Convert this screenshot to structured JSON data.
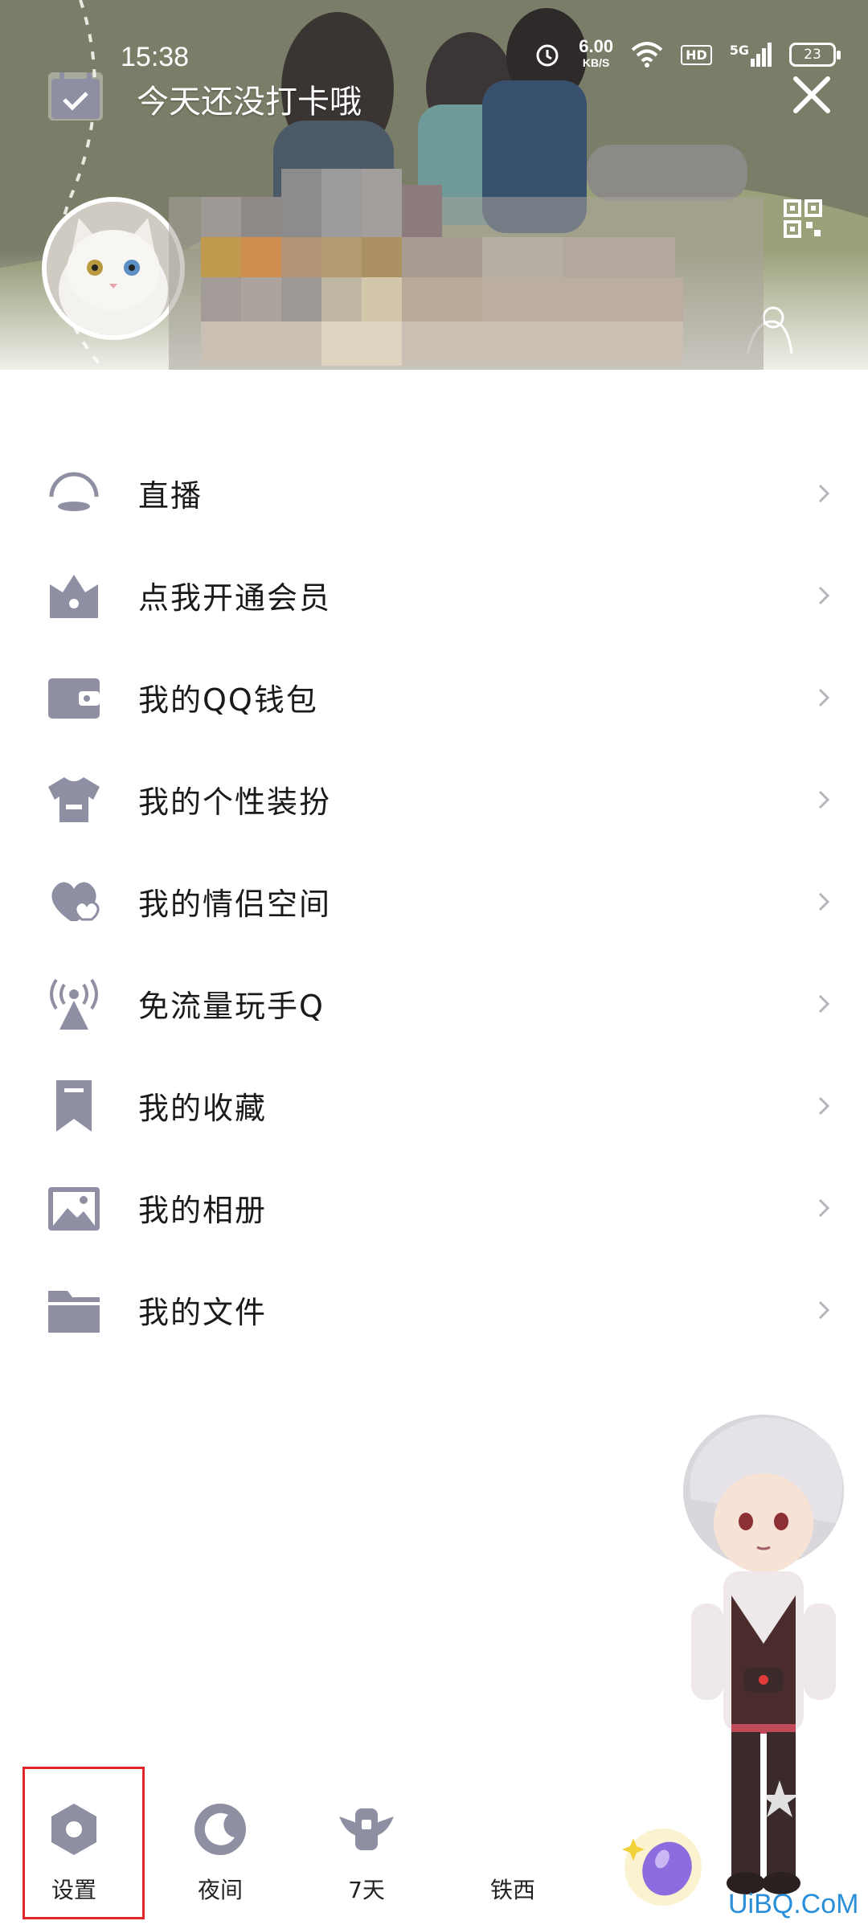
{
  "status_bar": {
    "time": "15:38",
    "net_speed": "6.00",
    "net_speed_unit": "KB/S",
    "hd_badge": "HD",
    "network": "5G",
    "battery": "23"
  },
  "header": {
    "checkin_text": "今天还没打卡哦"
  },
  "menu": {
    "items": [
      {
        "label": "直播",
        "icon": "live-icon"
      },
      {
        "label": "点我开通会员",
        "icon": "crown-icon"
      },
      {
        "label": "我的QQ钱包",
        "icon": "wallet-icon"
      },
      {
        "label": "我的个性装扮",
        "icon": "shirt-icon"
      },
      {
        "label": "我的情侣空间",
        "icon": "hearts-icon"
      },
      {
        "label": "免流量玩手Q",
        "icon": "signal-tower-icon"
      },
      {
        "label": "我的收藏",
        "icon": "bookmark-icon"
      },
      {
        "label": "我的相册",
        "icon": "photo-icon"
      },
      {
        "label": "我的文件",
        "icon": "folder-icon"
      }
    ]
  },
  "bottom_bar": {
    "settings_label": "设置",
    "night_label": "夜间",
    "weather_day_label": "7天",
    "city_label": "铁西"
  },
  "watermark": "UiBQ.CoM",
  "colors": {
    "icon_gray": "#8f8fa4",
    "chevron": "#b5b5bd",
    "highlight": "#e02626"
  }
}
